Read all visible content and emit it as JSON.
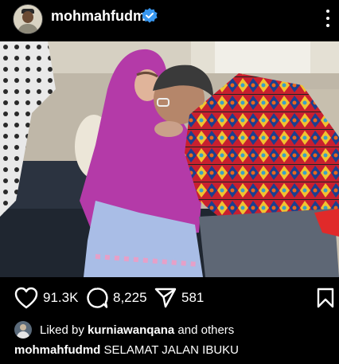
{
  "post": {
    "username": "mohmahfudmd",
    "verified": true,
    "accent_color": "#3897f0"
  },
  "actions": {
    "likes": "91.3K",
    "comments": "8,225",
    "shares": "581"
  },
  "liked_by": {
    "prefix": "Liked by",
    "user": "kurniawanqana",
    "suffix": "and others"
  },
  "caption": {
    "username": "mohmahfudmd",
    "text": "SELAMAT JALAN IBUKU"
  },
  "icons": [
    "heart-icon",
    "comment-icon",
    "share-icon",
    "bookmark-icon",
    "more-icon",
    "verified-icon"
  ]
}
